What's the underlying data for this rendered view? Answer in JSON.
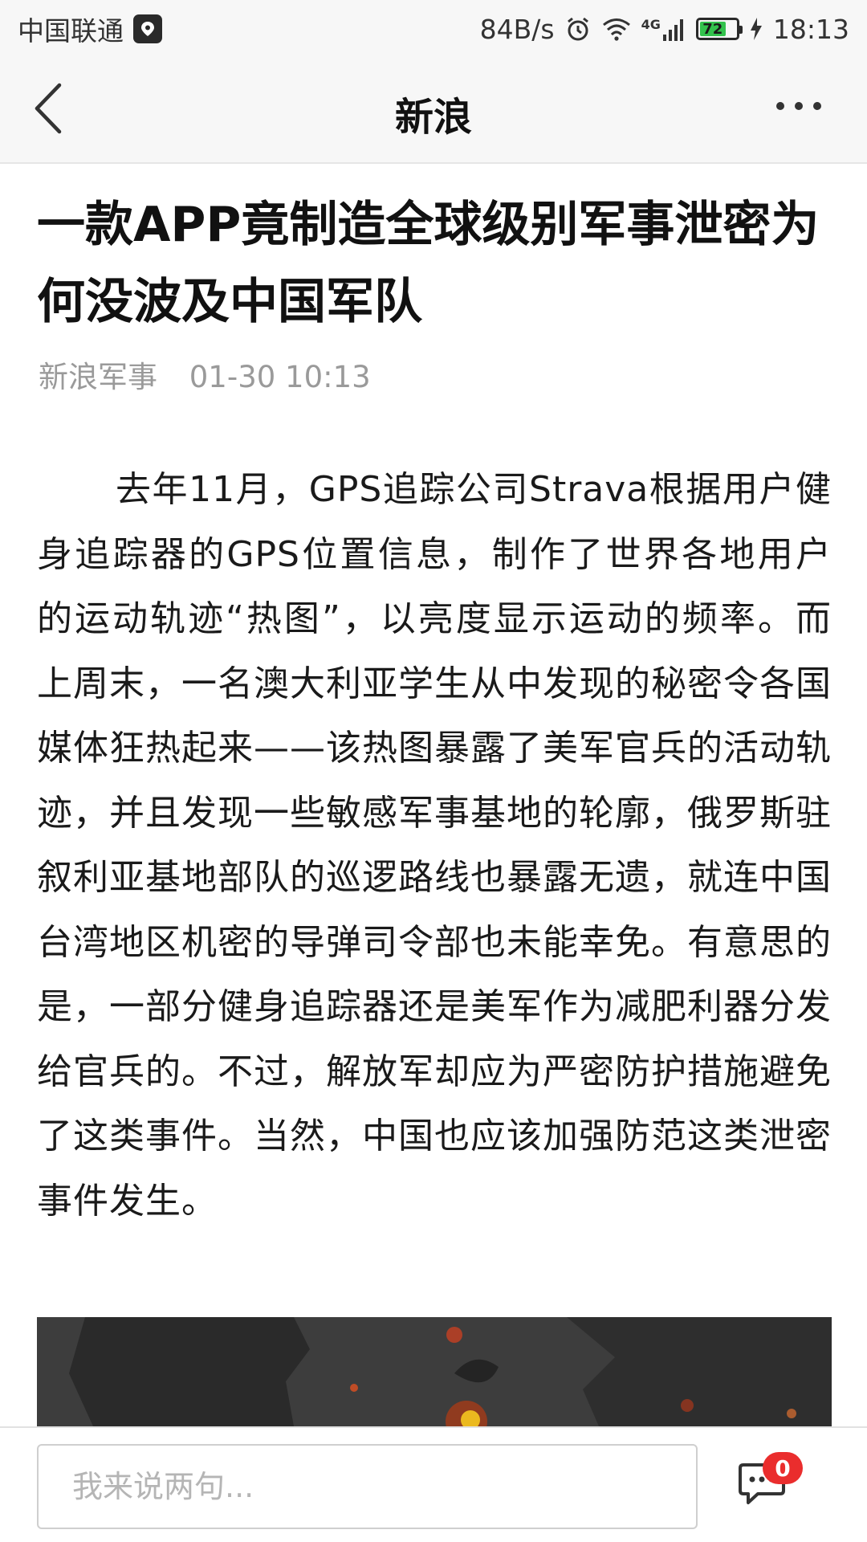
{
  "status_bar": {
    "carrier": "中国联通",
    "speed": "84B/s",
    "network": "4G",
    "battery": "72",
    "time": "18:13",
    "icons": [
      "carrier-app-icon",
      "alarm-icon",
      "wifi-icon",
      "signal-icon",
      "battery-icon",
      "charging-icon"
    ]
  },
  "nav": {
    "title": "新浪",
    "icons": [
      "back-arrow-icon",
      "more-icon"
    ]
  },
  "article": {
    "headline": "一款APP竟制造全球级别军事泄密为何没波及中国军队",
    "source": "新浪军事",
    "date": "01-30 10:13",
    "body": "去年11月，GPS追踪公司Strava根据用户健身追踪器的GPS位置信息，制作了世界各地用户的运动轨迹“热图”，以亮度显示运动的频率。而上周末，一名澳大利亚学生从中发现的秘密令各国媒体狂热起来——该热图暴露了美军官兵的活动轨迹，并且发现一些敏感军事基地的轮廓，俄罗斯驻叙利亚基地部队的巡逻路线也暴露无遗，就连中国台湾地区机密的导弹司令部也未能幸免。有意思的是，一部分健身追踪器还是美军作为减肥利器分发给官兵的。不过，解放军却应为严密防护措施避免了这类事件。当然，中国也应该加强防范这类泄密事件发生。"
  },
  "bottom_bar": {
    "comment_placeholder": "我来说两句...",
    "comment_count": "0",
    "icons": [
      "comment-icon"
    ]
  },
  "colors": {
    "background": "#ffffff",
    "bar_background": "#f7f7f7",
    "meta_text": "#9a9a9a",
    "badge": "#ea2d2d",
    "battery": "#33c24d",
    "map_background": "#3d3d3d"
  }
}
